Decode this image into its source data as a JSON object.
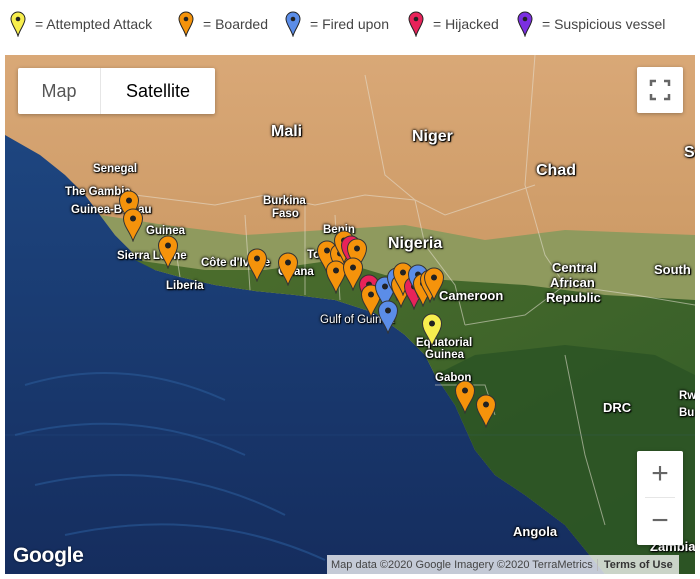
{
  "legend": [
    {
      "label": "= Attempted Attack",
      "color": "#f7ee4e",
      "icon": "yellow-marker-icon"
    },
    {
      "label": "= Boarded",
      "color": "#f5930b",
      "icon": "orange-marker-icon"
    },
    {
      "label": "= Fired upon",
      "color": "#5b8de8",
      "icon": "blue-marker-icon"
    },
    {
      "label": "= Hijacked",
      "color": "#e8235a",
      "icon": "red-marker-icon"
    },
    {
      "label": "= Suspicious vessel",
      "color": "#7b2fe0",
      "icon": "purple-marker-icon"
    }
  ],
  "map_type": {
    "map": "Map",
    "satellite": "Satellite",
    "selected": "Satellite"
  },
  "labels": {
    "mali": "Mali",
    "niger": "Niger",
    "chad": "Chad",
    "senegal": "Senegal",
    "the_gambia": "The Gambia",
    "guinea_bissau": "Guinea-Bissau",
    "guinea": "Guinea",
    "sierra_leone": "Sierra Leone",
    "liberia": "Liberia",
    "cote_divoire": "Côte d'Ivoire",
    "burkina_faso_1": "Burkina",
    "burkina_faso_2": "Faso",
    "ghana": "Ghana",
    "togo": "Togo",
    "benin": "Benin",
    "nigeria": "Nigeria",
    "cameroon": "Cameroon",
    "car_1": "Central",
    "car_2": "African",
    "car_3": "Republic",
    "south_sudan": "South",
    "gulf": "Gulf of Guinea",
    "eq_guinea_1": "Equatorial",
    "eq_guinea_2": "Guinea",
    "gabon": "Gabon",
    "drc": "DRC",
    "rwanda": "Rwanda",
    "burundi": "Burundi",
    "angola": "Angola",
    "zambia": "Zambia",
    "sudan": "Sudan"
  },
  "controls": {
    "zoom_in": "+",
    "zoom_out": "−"
  },
  "branding": {
    "logo": "Google"
  },
  "attribution": {
    "text": "Map data ©2020 Google Imagery ©2020 TerraMetrics",
    "terms": "Terms of Use"
  }
}
